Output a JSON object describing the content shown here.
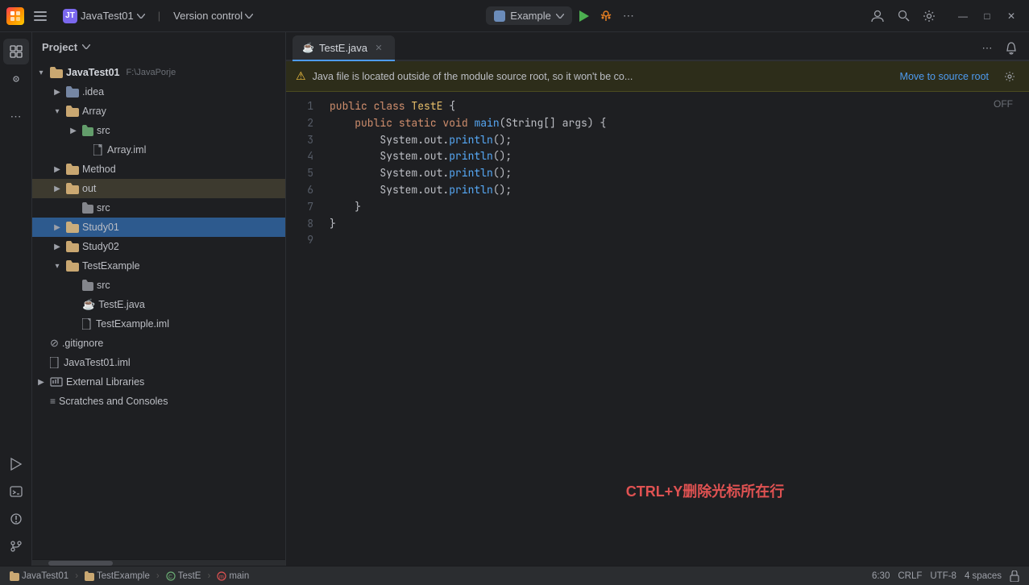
{
  "titlebar": {
    "logo": "JB",
    "menu_btn": "☰",
    "project_name": "JavaTest01",
    "project_initial": "JT",
    "vc_label": "Version control",
    "run_config": "Example",
    "run_btn": "▶",
    "debug_btn": "🐛",
    "more_btn": "⋯",
    "profile_icon": "👤",
    "search_icon": "🔍",
    "settings_icon": "⚙",
    "minimize": "—",
    "maximize": "□",
    "close": "✕"
  },
  "sidebar": {
    "folder_icon": "📁",
    "plugins_icon": "⊞",
    "more_icon": "⋯",
    "run_icon": "▷",
    "terminal_icon": "⊟",
    "todo_icon": "⊙",
    "git_icon": "⑂"
  },
  "project_panel": {
    "title": "Project",
    "chevron": "▾",
    "items": [
      {
        "indent": 0,
        "expanded": true,
        "icon": "📁",
        "label": "JavaTest01",
        "subtext": "F:\\JavaPorje",
        "bold": true,
        "arrow": "▾"
      },
      {
        "indent": 1,
        "expanded": false,
        "icon": "📁",
        "label": ".idea",
        "bold": false,
        "arrow": "▶"
      },
      {
        "indent": 1,
        "expanded": true,
        "icon": "📁",
        "label": "Array",
        "bold": false,
        "arrow": "▾"
      },
      {
        "indent": 2,
        "expanded": false,
        "icon": "📁",
        "label": "src",
        "bold": false,
        "arrow": "▶"
      },
      {
        "indent": 2,
        "expanded": false,
        "icon": "📄",
        "label": "Array.iml",
        "bold": false,
        "arrow": ""
      },
      {
        "indent": 1,
        "expanded": false,
        "icon": "📁",
        "label": "Method",
        "bold": false,
        "arrow": "▶"
      },
      {
        "indent": 1,
        "expanded": false,
        "icon": "📁",
        "label": "out",
        "bold": false,
        "arrow": "▶",
        "highlighted": true
      },
      {
        "indent": 2,
        "expanded": false,
        "icon": "📁",
        "label": "src",
        "bold": false,
        "arrow": ""
      },
      {
        "indent": 1,
        "expanded": true,
        "icon": "📁",
        "label": "Study01",
        "bold": false,
        "arrow": "▶",
        "selected": true
      },
      {
        "indent": 1,
        "expanded": false,
        "icon": "📁",
        "label": "Study02",
        "bold": false,
        "arrow": "▶"
      },
      {
        "indent": 1,
        "expanded": true,
        "icon": "📁",
        "label": "TestExample",
        "bold": false,
        "arrow": "▾"
      },
      {
        "indent": 2,
        "expanded": false,
        "icon": "📁",
        "label": "src",
        "bold": false,
        "arrow": ""
      },
      {
        "indent": 2,
        "expanded": false,
        "icon": "☕",
        "label": "TestE.java",
        "bold": false,
        "arrow": "",
        "java": true
      },
      {
        "indent": 2,
        "expanded": false,
        "icon": "📄",
        "label": "TestExample.iml",
        "bold": false,
        "arrow": ""
      },
      {
        "indent": 0,
        "expanded": false,
        "icon": "🚫",
        "label": ".gitignore",
        "bold": false,
        "arrow": ""
      },
      {
        "indent": 0,
        "expanded": false,
        "icon": "📄",
        "label": "JavaTest01.iml",
        "bold": false,
        "arrow": ""
      },
      {
        "indent": 0,
        "expanded": false,
        "icon": "📚",
        "label": "External Libraries",
        "bold": false,
        "arrow": "▶"
      },
      {
        "indent": 0,
        "expanded": false,
        "icon": "📋",
        "label": "Scratches and Consoles",
        "bold": false,
        "arrow": ""
      }
    ]
  },
  "editor": {
    "tab_icon": "☕",
    "tab_label": "TestE.java",
    "tab_close": "✕",
    "tab_more": "⋯",
    "bell": "🔔",
    "warning_text": "Java file is located outside of the module source root, so it won't be co...",
    "move_to_source": "Move to source root",
    "off_label": "OFF",
    "lines": [
      {
        "num": "1",
        "tokens": [
          {
            "t": "public ",
            "c": "kw"
          },
          {
            "t": "class ",
            "c": "kw"
          },
          {
            "t": "TestE",
            "c": "cls"
          },
          {
            "t": " {",
            "c": ""
          }
        ]
      },
      {
        "num": "2",
        "tokens": [
          {
            "t": "    public ",
            "c": "kw"
          },
          {
            "t": "static ",
            "c": "kw"
          },
          {
            "t": "void ",
            "c": "kw"
          },
          {
            "t": "main",
            "c": "fn"
          },
          {
            "t": "(String[] args) {",
            "c": ""
          }
        ]
      },
      {
        "num": "3",
        "tokens": [
          {
            "t": "        System.out.",
            "c": ""
          },
          {
            "t": "println",
            "c": "fn"
          },
          {
            "t": "();",
            "c": ""
          }
        ]
      },
      {
        "num": "4",
        "tokens": [
          {
            "t": "        System.out.",
            "c": ""
          },
          {
            "t": "println",
            "c": "fn"
          },
          {
            "t": "();",
            "c": ""
          }
        ]
      },
      {
        "num": "5",
        "tokens": [
          {
            "t": "        System.out.",
            "c": ""
          },
          {
            "t": "println",
            "c": "fn"
          },
          {
            "t": "();",
            "c": ""
          }
        ]
      },
      {
        "num": "6",
        "tokens": [
          {
            "t": "        System.out.",
            "c": ""
          },
          {
            "t": "println",
            "c": "fn"
          },
          {
            "t": "();",
            "c": ""
          }
        ]
      },
      {
        "num": "7",
        "tokens": [
          {
            "t": "    }",
            "c": ""
          }
        ]
      },
      {
        "num": "8",
        "tokens": [
          {
            "t": "}",
            "c": ""
          }
        ]
      },
      {
        "num": "9",
        "tokens": [
          {
            "t": "",
            "c": ""
          }
        ]
      }
    ],
    "annotation_key": "CTRL+Y",
    "annotation_text": "删除光标所在行"
  },
  "statusbar": {
    "project": "JavaTest01",
    "sep1": "›",
    "module": "TestExample",
    "sep2": "›",
    "class": "TestE",
    "sep3": "›",
    "method": "main",
    "position": "6:30",
    "line_ending": "CRLF",
    "encoding": "UTF-8",
    "indent": "4 spaces",
    "lock_icon": "🔒"
  }
}
